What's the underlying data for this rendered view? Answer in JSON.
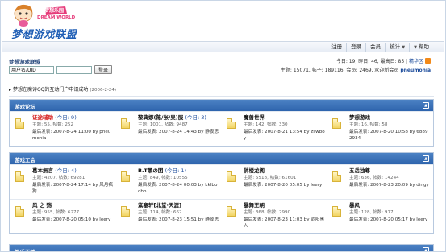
{
  "logo": {
    "tagline": "DREAM WORLD",
    "small": "梦想乐园",
    "title": "梦想游戏联盟"
  },
  "nav": {
    "items": [
      "注册",
      "登录",
      "会员",
      "统计",
      "帮助"
    ]
  },
  "site_title": "梦想游戏联盟",
  "login": {
    "username_value": "用户名/UID",
    "button": "登录"
  },
  "stats": {
    "line1": "今日: 19, 昨日: 46, 最高日: 85 |",
    "digest": "精华区",
    "line2": "主题: 15071, 帖子: 189116, 会员: 2469, 欢迎新会员",
    "new_member": "pneumonia"
  },
  "announcement": {
    "text": "梦想在魔诗QQ的互动门户申请成功",
    "date": "(2006-2-24)"
  },
  "sections": [
    {
      "title": "游戏论坛",
      "rows": [
        [
          {
            "name": "证途辅助",
            "today": "(今日: 9)",
            "stat": "主题: 55, 帖数: 252",
            "last": "最后发表: 2007-8-24 11:00 by pneumonia",
            "red": true
          },
          {
            "name": "黎典娜(陈/张/吴)服",
            "today": "(今日: 3)",
            "stat": "主题: 1001, 帖数: 9487",
            "last": "最后发表: 2007-8-24 14:43 by 静夜思",
            "red": false
          },
          {
            "name": "魔兽世界",
            "today": "",
            "stat": "主题: 142, 帖数: 330",
            "last": "最后发表: 2007-8-21 13:54 by zswboy",
            "red": false
          },
          {
            "name": "梦想游戏",
            "today": "",
            "stat": "主题: 16, 帖数: 58",
            "last": "最后发表: 2007-8-20 10:58 by 68892934",
            "red": false
          }
        ]
      ]
    },
    {
      "title": "游戏工会",
      "rows": [
        [
          {
            "name": "葛本無言",
            "today": "(今日: 4)",
            "stat": "主题: 4207, 帖数: 69281",
            "last": "最后发表: 2007-8-24 17:14 by 风月疯狗",
            "red": false
          },
          {
            "name": "B.T黑の团",
            "today": "(今日: 1)",
            "stat": "主题: 849, 帖数: 10555",
            "last": "最后发表: 2007-8-24 00:03 by kklbbobo",
            "red": false
          },
          {
            "name": "俏楼龙阁",
            "today": "",
            "stat": "主题: 5518, 帖数: 61601",
            "last": "最后发表: 2007-8-20 05:05 by leery",
            "red": false
          },
          {
            "name": "五岳独尊",
            "today": "",
            "stat": "主题: 636, 帖数: 14244",
            "last": "最后发表: 2007-8-23 20:09 by dingy",
            "red": false
          }
        ],
        [
          {
            "name": "风 之 殇",
            "today": "",
            "stat": "主题: 955, 帖数: 6277",
            "last": "最后发表: 2007-8-20 05:10 by leery",
            "red": false
          },
          {
            "name": "紫塞轩[北堂·天涯]",
            "today": "",
            "stat": "主题: 114, 帖数: 662",
            "last": "最后发表: 2007-8-23 15:51 by 静夜思",
            "red": false
          },
          {
            "name": "暴舞王朝",
            "today": "",
            "stat": "主题: 368, 帖数: 2990",
            "last": "最后发表: 2007-8-23 11:03 by 韵阳黑人",
            "red": false
          },
          {
            "name": "暴风",
            "today": "",
            "stat": "主题: 128, 帖数: 977",
            "last": "最后发表: 2007-8-20 05:17 by leery",
            "red": false
          }
        ]
      ]
    },
    {
      "title": "娱乐天地",
      "rows": []
    }
  ]
}
